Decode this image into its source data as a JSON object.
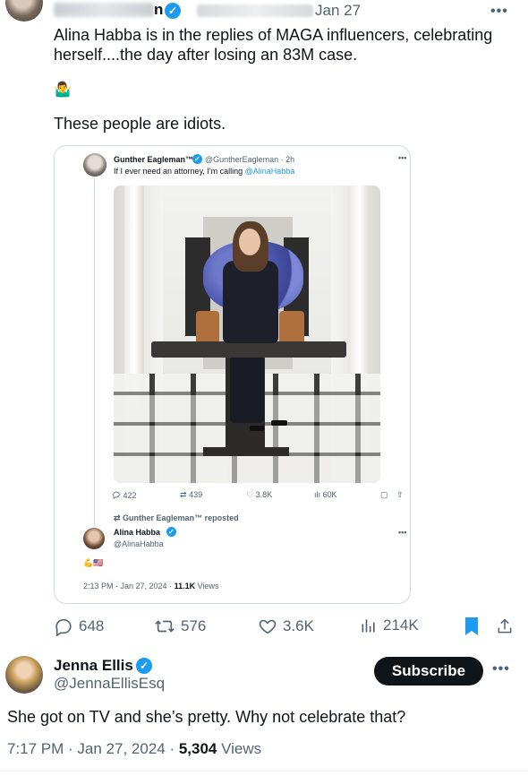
{
  "colors": {
    "accent": "#1d9bf0",
    "text": "#0f1419",
    "muted": "#536471",
    "border": "#cfd9de"
  },
  "top_tweet": {
    "name_tail": "n",
    "date": "Jan 27",
    "text_line1": "Alina Habba is in the replies of MAGA influencers, celebrating",
    "text_line2": "herself....the day after losing an 83M case.",
    "emoji": "🤷‍♂️",
    "text2": "These people are idiots.",
    "more": "•••"
  },
  "quoted": {
    "name": "Gunther Eagleman™",
    "handle_time": "@GuntherEagleman · 2h",
    "text_prefix": "If I ever need an attorney, I'm calling ",
    "mention": "@AlinaHabba",
    "more": "•••",
    "stats": {
      "replies": "422",
      "reposts": "439",
      "likes": "3.8K",
      "views": "60K"
    },
    "reposted_by": "Gunther Eagleman™ reposted",
    "author_name": "Alina Habba",
    "author_handle": "@AlinaHabba",
    "author_emoji": "💪🇺🇸",
    "meta_time": "2:13 PM · Jan 27, 2024 · ",
    "meta_views_count": "11.1K",
    "meta_views_label": " Views"
  },
  "actions": {
    "replies": "648",
    "reposts": "576",
    "likes": "3.6K",
    "views": "214K"
  },
  "reply": {
    "name": "Jenna Ellis",
    "handle": "@JennaEllisEsq",
    "subscribe_label": "Subscribe",
    "more": "•••",
    "text": "She got on TV and she’s pretty. Why not celebrate that?",
    "meta_time": "7:17 PM · Jan 27, 2024 · ",
    "meta_views_count": "5,304",
    "meta_views_label": " Views"
  },
  "icons": {
    "reply": "reply-icon",
    "repost": "repost-icon",
    "like": "heart-icon",
    "views": "bar-chart-icon",
    "bookmark": "bookmark-icon",
    "share": "share-icon",
    "verified": "verified-badge-icon"
  }
}
